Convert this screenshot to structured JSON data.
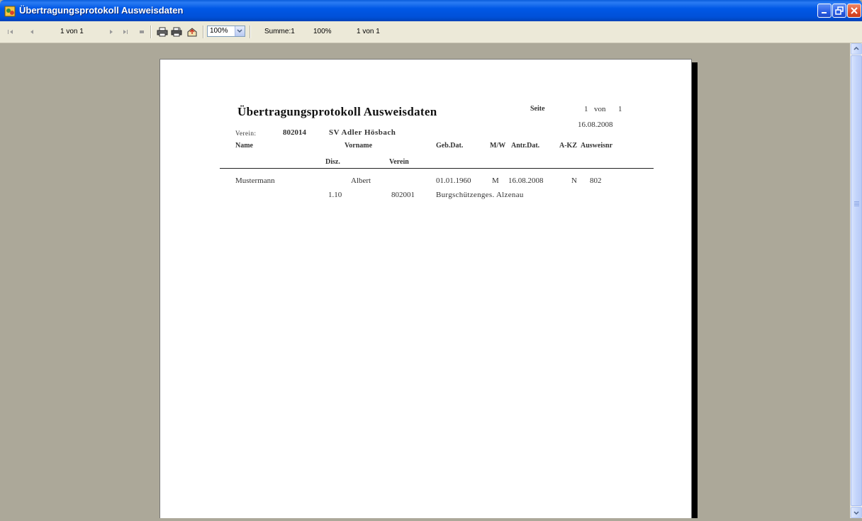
{
  "window": {
    "title": "Übertragungsprotokoll Ausweisdaten",
    "controls": [
      "minimize",
      "maximize",
      "close"
    ]
  },
  "toolbar": {
    "page_display": "1 von 1",
    "zoom_select": "100%",
    "status_total": "Summe:1",
    "status_zoom": "100%",
    "status_page": "1 von 1",
    "icons": [
      "first-page-icon",
      "previous-page-icon",
      "next-page-icon",
      "last-page-icon",
      "stop-icon",
      "print-icon",
      "print-setup-icon",
      "export-icon"
    ]
  },
  "report": {
    "title": "Übertragungsprotokoll Ausweisdaten",
    "page_label": "Seite",
    "page_number": "1",
    "page_of": "von",
    "page_total": "1",
    "date": "16.08.2008",
    "club_label": "Verein:",
    "club_number": "802014",
    "club_name": "SV Adler Hösbach",
    "headers": {
      "name": "Name",
      "vorname": "Vorname",
      "gebdat": "Geb.Dat.",
      "mw": "M/W",
      "antrdat": "Antr.Dat.",
      "akz": "A-KZ",
      "ausweisnr": "Ausweisnr",
      "disz": "Disz.",
      "verein": "Verein"
    },
    "rows": [
      {
        "name": "Mustermann",
        "vorname": "Albert",
        "gebdat": "01.01.1960",
        "mw": "M",
        "antrdat": "16.08.2008",
        "akz": "N",
        "ausweisnr": "802",
        "disz": "1.10",
        "verein_nr": "802001",
        "verein_name": "Burgschützenges. Alzenau"
      }
    ]
  },
  "colors": {
    "titlebar": "#0058e6",
    "toolbar": "#ece9d8",
    "workspace": "#aca899",
    "page": "#ffffff"
  }
}
